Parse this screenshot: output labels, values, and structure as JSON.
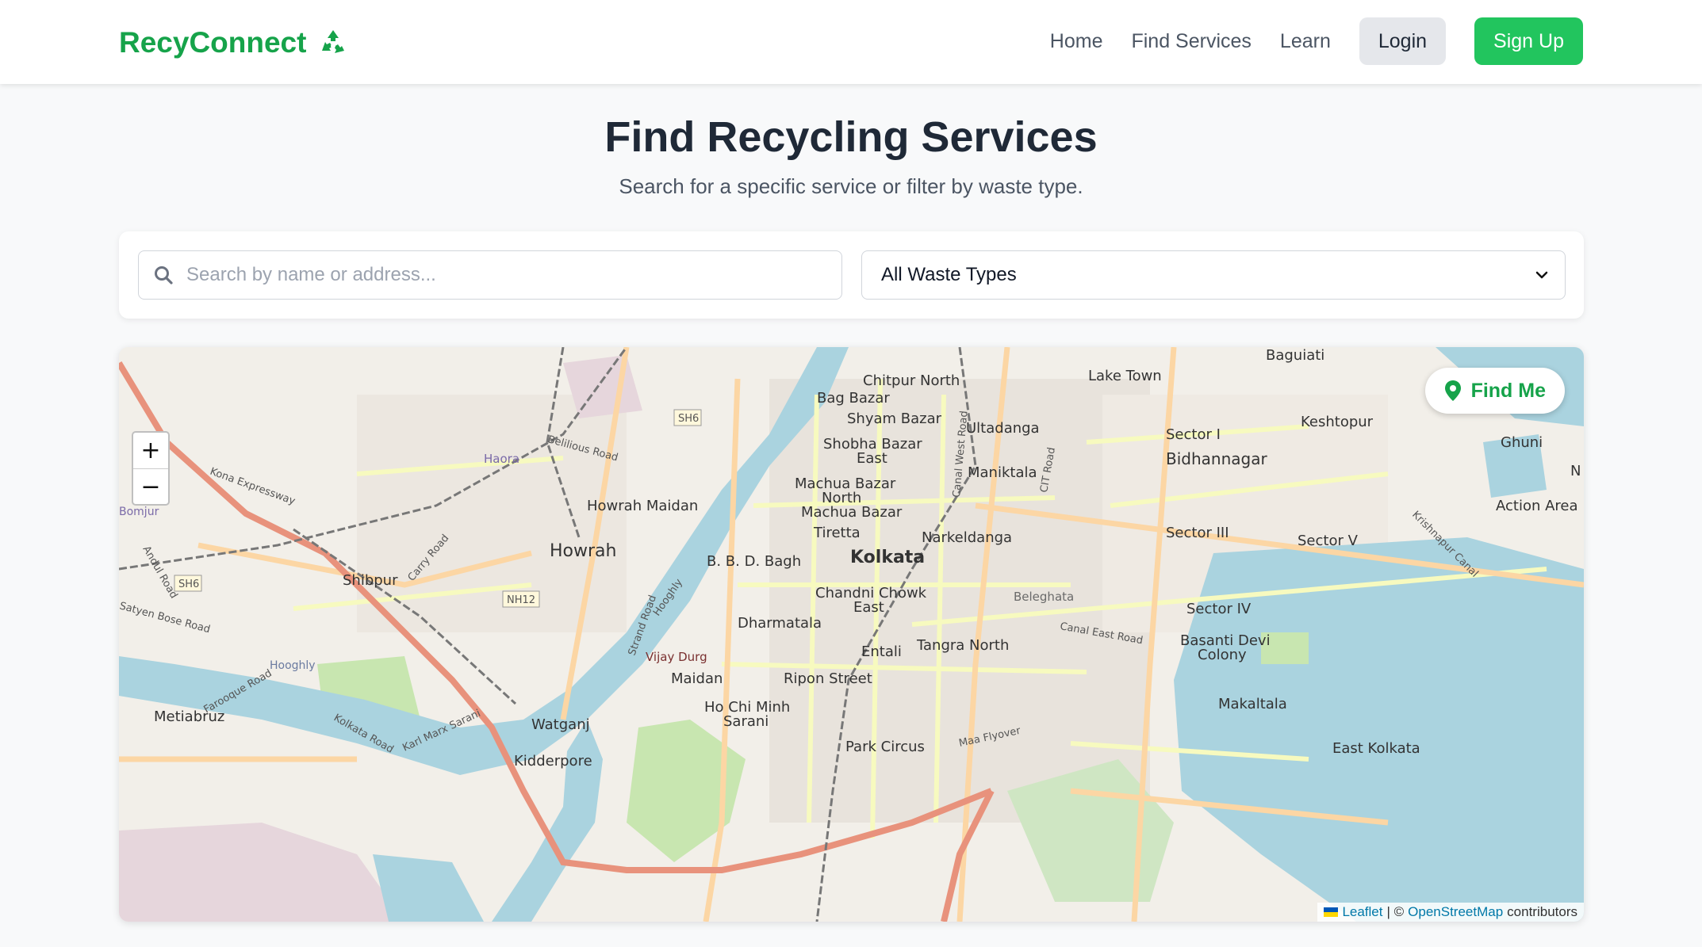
{
  "brand": {
    "name": "RecyConnect",
    "icon": "recycle-icon",
    "color": "#16a34a"
  },
  "nav": {
    "links": [
      {
        "label": "Home"
      },
      {
        "label": "Find Services"
      },
      {
        "label": "Learn"
      }
    ],
    "login_label": "Login",
    "signup_label": "Sign Up"
  },
  "page": {
    "title": "Find Recycling Services",
    "subtitle": "Search for a specific service or filter by waste type."
  },
  "filters": {
    "search_placeholder": "Search by name or address...",
    "search_value": "",
    "waste_type_selected": "All Waste Types"
  },
  "map": {
    "find_me_label": "Find Me",
    "zoom_in": "+",
    "zoom_out": "−",
    "attribution": {
      "leaflet": "Leaflet",
      "separator": "| ©",
      "osm": "OpenStreetMap",
      "suffix": "contributors"
    },
    "place_labels": [
      "Baguiati",
      "Lake Town",
      "Chitpur North",
      "Bag Bazar",
      "Shyam Bazar",
      "Ultadanga",
      "Shobha Bazar East",
      "Maniktala",
      "Machua Bazar North",
      "Machua Bazar",
      "Howrah Maidan",
      "Tiretta",
      "Narkeldanga",
      "Howrah",
      "B. B. D. Bagh",
      "Kolkata",
      "Shibpur",
      "Chandni Chowk East",
      "Dharmatala",
      "Tangra North",
      "Entali",
      "Maidan",
      "Ripon Street",
      "Ho Chi Minh Sarani",
      "Park Circus",
      "Watganj",
      "Metiabruz",
      "Kidderpore",
      "Keshtopur",
      "Ghuni",
      "Sector I",
      "Bidhannagar",
      "Sector III",
      "Sector V",
      "Action Area",
      "Sector IV",
      "Basanti Devi Colony",
      "Makaltala",
      "East Kolkata",
      "Hooghly",
      "Beleghata",
      "Vijay Durg",
      "SH6",
      "NH12",
      "Kona Expressway",
      "Andul Road",
      "Satyen Bose Road",
      "Carry Road",
      "Belilious Road",
      "Canal West Road",
      "CIT Road",
      "Canal East Road",
      "Strand Road",
      "Karl Marx Sarani",
      "Farooque Road",
      "Kolkata Road",
      "Maa Flyover",
      "Krishnapur Canal",
      "Haora",
      "Bomjur",
      "N"
    ]
  },
  "colors": {
    "accent": "#22c55e",
    "accent_dark": "#16a34a",
    "water": "#aad3df",
    "land": "#f2efe9"
  }
}
